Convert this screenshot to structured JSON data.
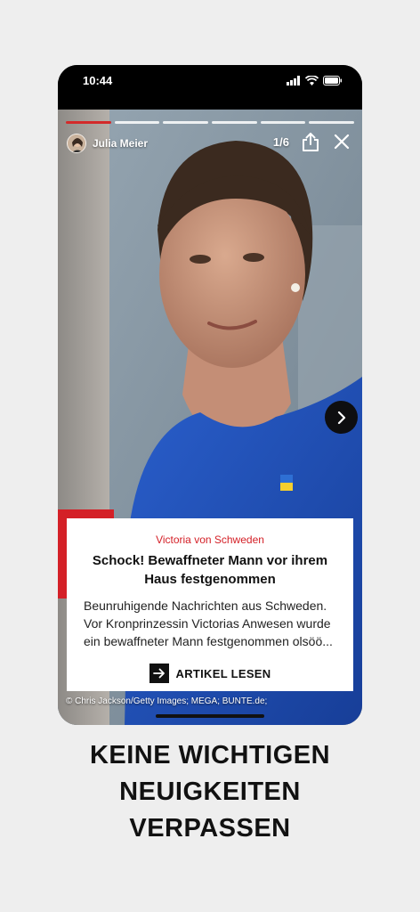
{
  "status_bar": {
    "time": "10:44"
  },
  "story": {
    "author": "Julia Meier",
    "counter": "1/6",
    "progress": {
      "total": 6,
      "current": 1
    },
    "card": {
      "kicker": "Victoria von Schweden",
      "headline": "Schock! Bewaffneter Mann vor ihrem Haus festgenommen",
      "teaser": "Beunruhigende Nachrichten aus Schweden. Vor Kronprinzessin Victorias Anwesen wurde ein bewaffneter Mann festgenommen olsöö...",
      "cta_label": "ARTIKEL LESEN"
    },
    "credit": "© Chris Jackson/Getty Images; MEGA; BUNTE.de;"
  },
  "tagline": {
    "line1": "KEINE WICHTIGEN",
    "line2": "NEUIGKEITEN",
    "line3": "VERPASSEN"
  },
  "colors": {
    "accent": "#d42027",
    "background": "#eeeeee",
    "dress": "#1f4fb5"
  },
  "icons": [
    "signal-icon",
    "wifi-icon",
    "battery-icon",
    "share-icon",
    "close-icon",
    "chevron-right-icon",
    "arrow-right-icon"
  ]
}
